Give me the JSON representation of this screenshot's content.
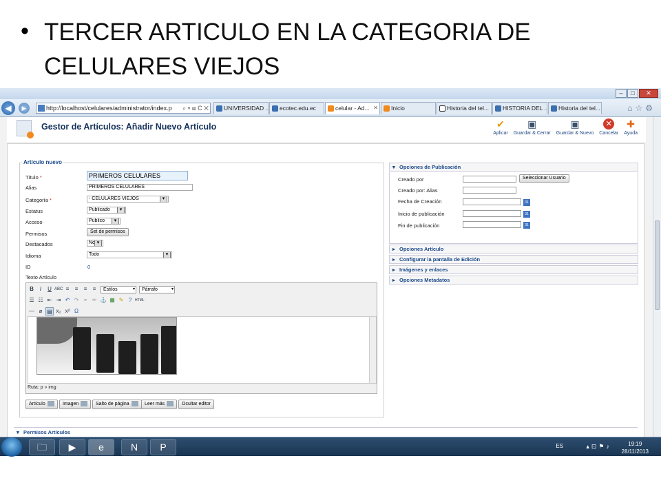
{
  "slide": {
    "bullet": "•",
    "title": "TERCER ARTICULO EN LA CATEGORIA DE CELULARES VIEJOS"
  },
  "browser": {
    "url": "http://localhost/celulares/administrator/index.p",
    "url_icons": "⌕ ▾ ⊠ C ✕",
    "tabs": [
      {
        "label": "UNIVERSIDAD ...",
        "active": false
      },
      {
        "label": "ecotec.edu.ec",
        "active": false
      },
      {
        "label": "celular - Ad...",
        "active": true
      },
      {
        "label": "Inicio",
        "active": false
      },
      {
        "label": "Historia del tel...",
        "active": false
      },
      {
        "label": "HISTORIA DEL ...",
        "active": false
      },
      {
        "label": "Historia del tel...",
        "active": false
      }
    ]
  },
  "header": {
    "title": "Gestor de Artículos: Añadir Nuevo Artículo",
    "toolbar": {
      "apply": "Aplicar",
      "save_close": "Guardar & Cerrar",
      "save_new": "Guardar & Nuevo",
      "cancel": "Cancelar",
      "help": "Ayuda"
    }
  },
  "article": {
    "legend": "Artículo nuevo",
    "title_label": "Título",
    "title_value": "PRIMEROS CELULARES",
    "alias_label": "Alias",
    "alias_value": "PRIMEROS CELULARES",
    "category_label": "Categoría",
    "category_value": "- CELULARES VIEJOS",
    "status_label": "Estatus",
    "status_value": "Publicado",
    "access_label": "Acceso",
    "access_value": "Publico",
    "permissions_label": "Permisos",
    "permissions_button": "Set de permisos",
    "featured_label": "Destacados",
    "featured_value": "No",
    "language_label": "Idioma",
    "language_value": "Todo",
    "id_label": "ID",
    "id_value": "0",
    "text_label": "Texto Artículo",
    "required_mark": "*"
  },
  "editor": {
    "styles": "Estilos",
    "paragraph": "Párrafo",
    "path": "Ruta: p » img",
    "buttons": {
      "article": "Artículo",
      "image": "Imagen",
      "pagebreak": "Salto de página",
      "readmore": "Leer más",
      "toggle": "Ocultar editor"
    }
  },
  "publishing": {
    "title": "Opciones de Publicación",
    "created_by": "Creado por",
    "select_user": "Seleccionar Usuario",
    "created_by_alias": "Creado por: Alias",
    "created_date": "Fecha de Creación",
    "publish_up": "Inicio de publicación",
    "publish_down": "Fin de publicación"
  },
  "panels": {
    "article_options": "Opciones Artículo",
    "edit_screen": "Configurar la pantalla de Edición",
    "images_links": "Imágenes y enlaces",
    "metadata": "Opciones Metadatos",
    "permissions": "Permisos Artículos"
  },
  "taskbar": {
    "language": "ES",
    "time": "19:19",
    "date": "28/11/2013"
  }
}
